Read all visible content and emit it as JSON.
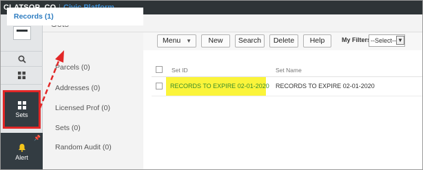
{
  "app": {
    "agency": "CLATSOP_CO",
    "platform": "Civic Platform"
  },
  "rail": {
    "sets_label": "Sets",
    "alert_label": "Alert"
  },
  "page": {
    "title": "Sets"
  },
  "subnav": {
    "items": [
      {
        "label": "Records (1)"
      },
      {
        "label": "Parcels (0)"
      },
      {
        "label": "Addresses (0)"
      },
      {
        "label": "Licensed Prof (0)"
      },
      {
        "label": "Sets (0)"
      },
      {
        "label": "Random Audit (0)"
      }
    ]
  },
  "toolbar": {
    "menu_label": "Menu",
    "new_label": "New",
    "search_label": "Search",
    "delete_label": "Delete",
    "help_label": "Help",
    "filters_label": "My Filters",
    "filters_value": "--Select--"
  },
  "table": {
    "columns": [
      "Set ID",
      "Set Name"
    ],
    "rows": [
      {
        "set_id": "RECORDS TO EXPIRE 02-01-2020",
        "set_name": "RECORDS TO EXPIRE 02-01-2020"
      }
    ]
  },
  "colors": {
    "topbar": "#2e3437",
    "accent": "#2b7bc0",
    "highlight": "#fbf43a",
    "annotation": "#e22727"
  },
  "icons": [
    "logo-icon",
    "search-icon",
    "grid-icon",
    "sets-icon",
    "bell-icon",
    "pin-icon",
    "chevron-down-icon"
  ]
}
